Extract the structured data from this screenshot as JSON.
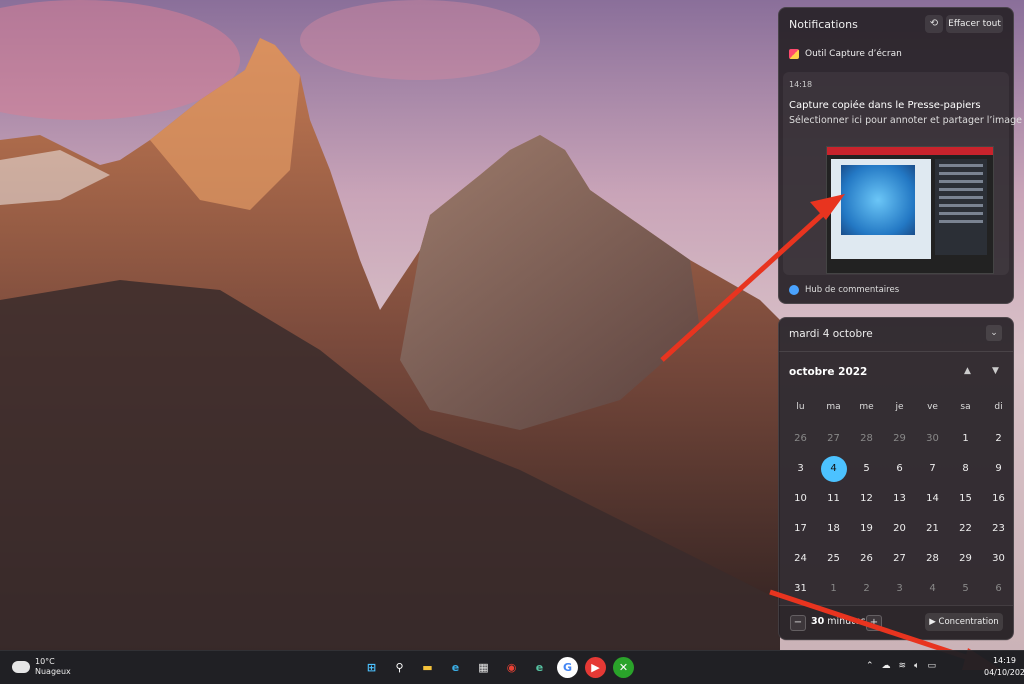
{
  "notifications": {
    "title": "Notifications",
    "dnd_icon": "⟲",
    "clear_all": "Effacer tout",
    "app_name": "Outil Capture d’écran",
    "time": "14:18",
    "card_title": "Capture copiée dans le Presse-papiers",
    "card_subtitle": "Sélectionner ici pour annoter et partager l’image",
    "feedback_hub": "Hub de commentaires"
  },
  "calendar": {
    "date_header": "mardi 4 octobre",
    "month": "octobre 2022",
    "weekdays": [
      "lu",
      "ma",
      "me",
      "je",
      "ve",
      "sa",
      "di"
    ],
    "weeks": [
      [
        "26",
        "27",
        "28",
        "29",
        "30",
        "1",
        "2"
      ],
      [
        "3",
        "4",
        "5",
        "6",
        "7",
        "8",
        "9"
      ],
      [
        "10",
        "11",
        "12",
        "13",
        "14",
        "15",
        "16"
      ],
      [
        "17",
        "18",
        "19",
        "20",
        "21",
        "22",
        "23"
      ],
      [
        "24",
        "25",
        "26",
        "27",
        "28",
        "29",
        "30"
      ],
      [
        "31",
        "1",
        "2",
        "3",
        "4",
        "5",
        "6"
      ]
    ],
    "today": "4",
    "focus_minutes": "30",
    "focus_unit": "minutes",
    "focus_button": "Concentration",
    "accent_color": "#4cc2ff"
  },
  "taskbar": {
    "temperature": "10°C",
    "weather": "Nuageux",
    "apps": [
      {
        "name": "start-icon",
        "glyph": "⊞",
        "color": "#4cc2ff",
        "bg": "transparent"
      },
      {
        "name": "search-icon",
        "glyph": "⚲",
        "color": "#ffffff",
        "bg": "transparent"
      },
      {
        "name": "file-explorer-icon",
        "glyph": "▬",
        "color": "#f5c33b",
        "bg": "transparent"
      },
      {
        "name": "edge-icon",
        "glyph": "e",
        "color": "#3bb0e8",
        "bg": "transparent"
      },
      {
        "name": "store-icon",
        "glyph": "▦",
        "color": "#e9e9e9",
        "bg": "transparent"
      },
      {
        "name": "chrome-icon",
        "glyph": "◉",
        "color": "#e94235",
        "bg": "transparent"
      },
      {
        "name": "edge-beta-icon",
        "glyph": "e",
        "color": "#56c3a2",
        "bg": "transparent"
      },
      {
        "name": "google-icon",
        "glyph": "G",
        "color": "#4285f4",
        "bg": "#ffffff"
      },
      {
        "name": "youtube-music-icon",
        "glyph": "▶",
        "color": "#ffffff",
        "bg": "#e53935"
      },
      {
        "name": "xbox-icon",
        "glyph": "✕",
        "color": "#ffffff",
        "bg": "#2aa32a"
      }
    ],
    "time": "14:19",
    "date": "04/10/2022"
  }
}
